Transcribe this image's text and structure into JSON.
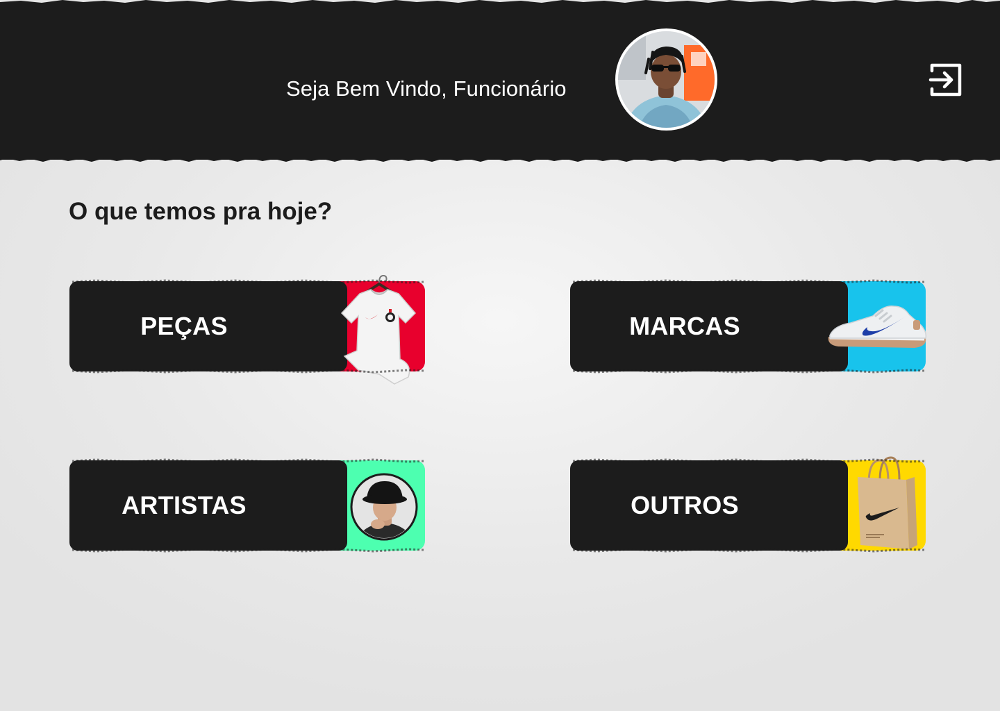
{
  "header": {
    "welcome_text": "Seja Bem Vindo, Funcionário",
    "avatar_icon": "user-avatar",
    "logout_icon": "logout-icon"
  },
  "main": {
    "title": "O que temos pra hoje?",
    "categories": [
      {
        "label": "PEÇAS",
        "accent": "#e8002d",
        "icon": "jersey-icon"
      },
      {
        "label": "MARCAS",
        "accent": "#18c3ec",
        "icon": "sneaker-icon"
      },
      {
        "label": "ARTISTAS",
        "accent": "#4dffb0",
        "icon": "artist-avatar"
      },
      {
        "label": "OUTROS",
        "accent": "#ffd900",
        "icon": "shopping-bag-icon"
      }
    ]
  },
  "colors": {
    "header_bg": "#1c1c1c",
    "card_bg": "#1c1c1c",
    "page_bg": "#ececec",
    "text_light": "#ffffff",
    "text_dark": "#1c1c1c"
  }
}
